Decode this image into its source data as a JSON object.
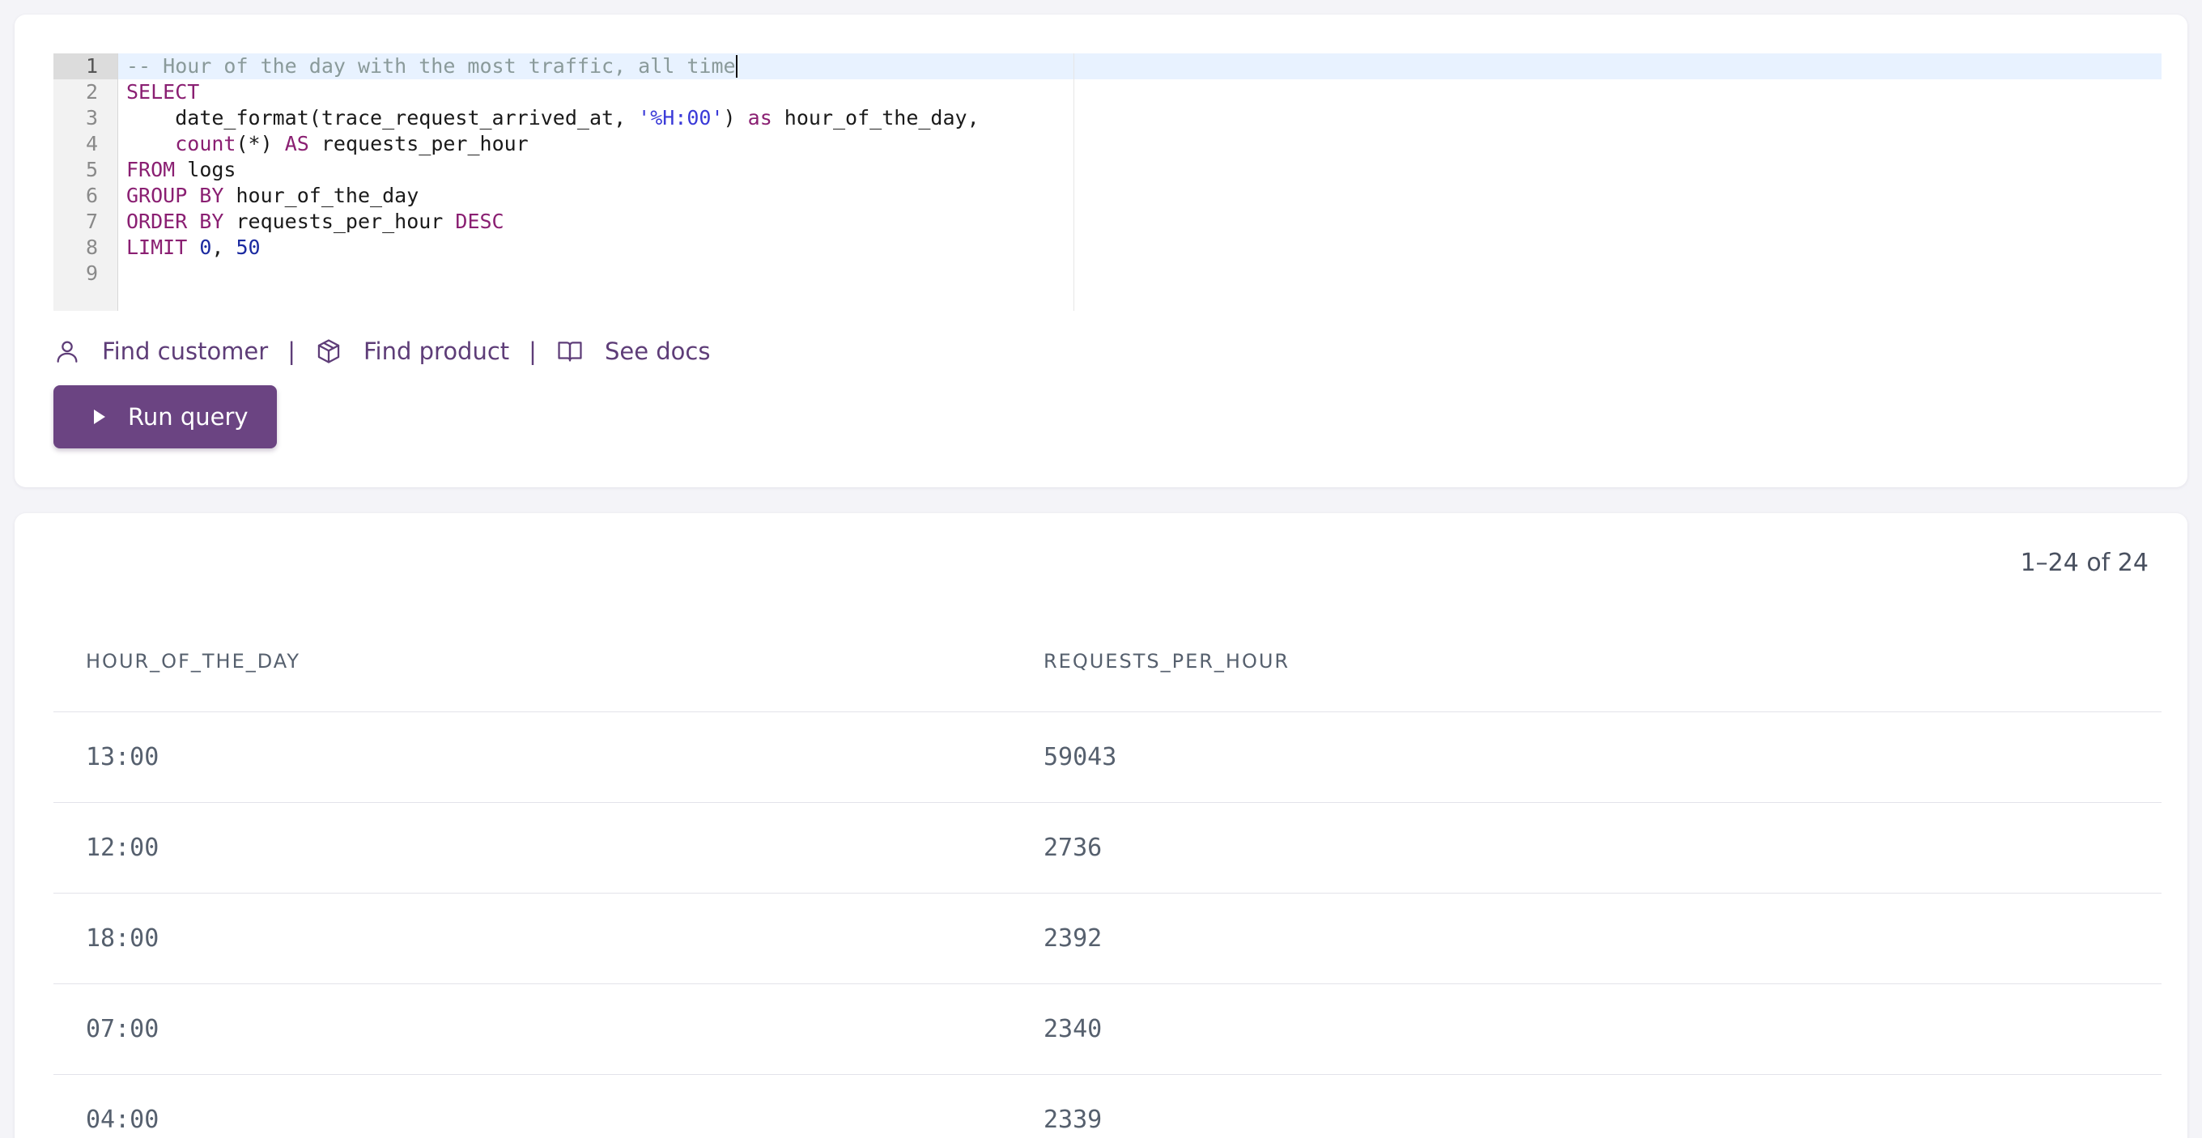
{
  "editor": {
    "line_numbers": [
      "1",
      "2",
      "3",
      "4",
      "5",
      "6",
      "7",
      "8",
      "9"
    ],
    "active_line": 1
  },
  "code": {
    "l1_comment": "-- Hour of the day with the most traffic, all time",
    "l2_kw": "SELECT",
    "l3_indent": "    ",
    "l3_fn": "date_format(trace_request_arrived_at, ",
    "l3_str": "'%H:00'",
    "l3_close": ") ",
    "l3_kw": "as",
    "l3_rest": " hour_of_the_day,",
    "l4_indent": "    ",
    "l4_fn": "count",
    "l4_mid": "(*) ",
    "l4_kw": "AS",
    "l4_rest": " requests_per_hour",
    "l5_kw": "FROM",
    "l5_rest": " logs",
    "l6_kw": "GROUP BY",
    "l6_rest": " hour_of_the_day",
    "l7_kw": "ORDER BY",
    "l7_mid": " requests_per_hour ",
    "l7_kw2": "DESC",
    "l8_kw": "LIMIT",
    "l8_sp": " ",
    "l8_n1": "0",
    "l8_comma": ", ",
    "l8_n2": "50"
  },
  "helpers": {
    "find_customer": "Find customer",
    "find_product": "Find product",
    "see_docs": "See docs",
    "separator": "|",
    "icons": [
      "user-icon",
      "package-icon",
      "book-icon"
    ]
  },
  "run_button": {
    "label": "Run query"
  },
  "results": {
    "pagination": "1–24 of 24",
    "columns": [
      "HOUR_OF_THE_DAY",
      "REQUESTS_PER_HOUR"
    ],
    "rows": [
      [
        "13:00",
        "59043"
      ],
      [
        "12:00",
        "2736"
      ],
      [
        "18:00",
        "2392"
      ],
      [
        "07:00",
        "2340"
      ],
      [
        "04:00",
        "2339"
      ]
    ]
  },
  "colors": {
    "accent": "#6b4482",
    "link": "#5e3d78",
    "keyword": "#8a1f72",
    "string": "#3a3ad8",
    "comment": "#8a9a9a",
    "active_line_bg": "#e8f2ff"
  }
}
